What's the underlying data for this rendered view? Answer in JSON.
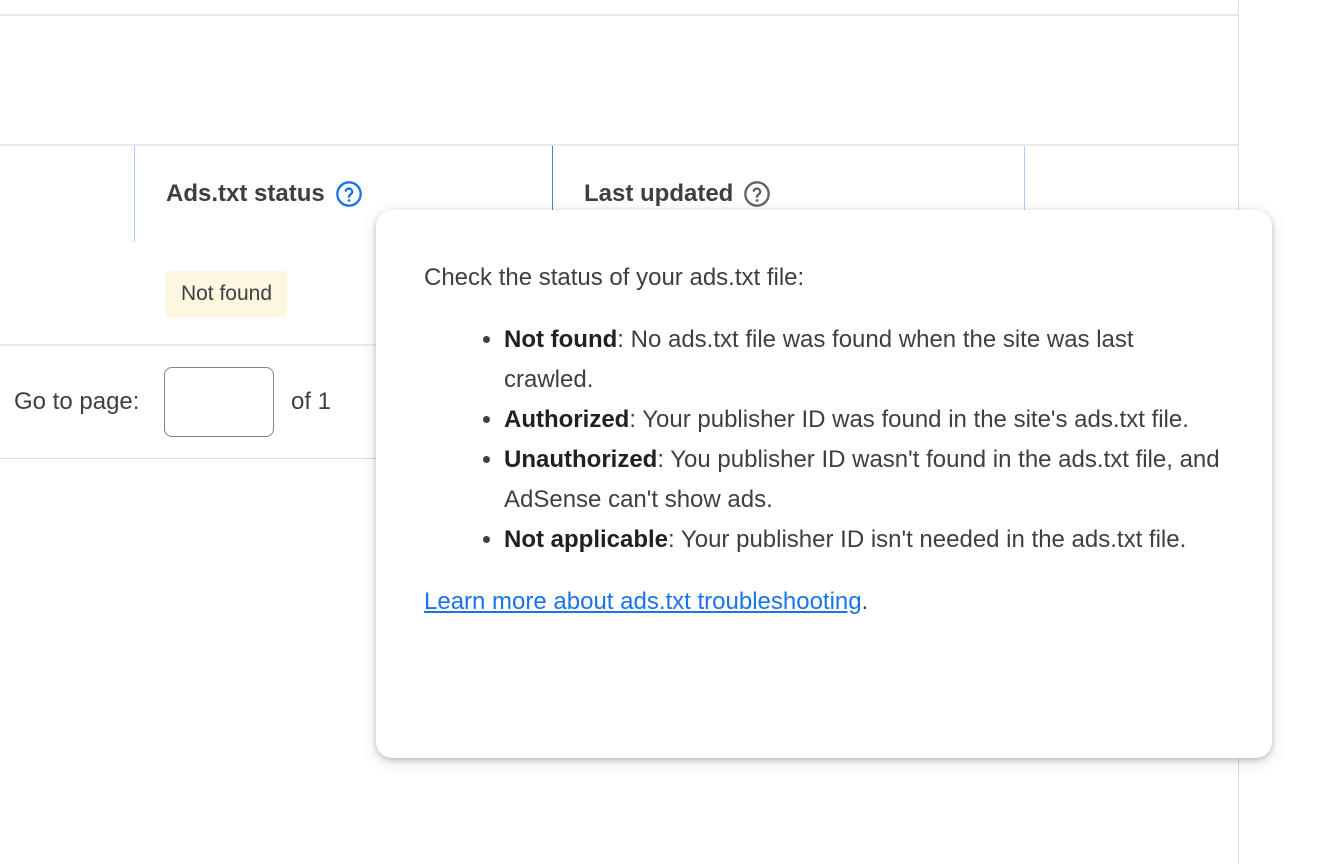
{
  "table": {
    "columns": [
      {
        "label": "Ads.txt status",
        "help_icon": "help-circle-icon",
        "help_active": true
      },
      {
        "label": "Last updated",
        "help_icon": "help-circle-icon",
        "help_active": false
      }
    ],
    "row": {
      "ads_txt_status": "Not found"
    },
    "pagination": {
      "goto_label": "Go to page:",
      "input_value": "",
      "of_label": "of 1"
    }
  },
  "tooltip": {
    "intro": "Check the status of your ads.txt file:",
    "items": [
      {
        "term": "Not found",
        "desc": ": No ads.txt file was found when the site was last crawled."
      },
      {
        "term": "Authorized",
        "desc": ": Your publisher ID was found in the site's ads.txt file."
      },
      {
        "term": "Unauthorized",
        "desc": ": You publisher ID wasn't found in the ads.txt file, and AdSense can't show ads."
      },
      {
        "term": "Not applicable",
        "desc": ": Your publisher ID isn't needed in the ads.txt file."
      }
    ],
    "link_text": "Learn more about ads.txt troubleshooting",
    "link_suffix": "."
  },
  "colors": {
    "active_help_icon": "#1a73e8",
    "inactive_help_icon": "#5f6368",
    "status_chip_bg": "#fef7e0",
    "link": "#1a73e8"
  }
}
